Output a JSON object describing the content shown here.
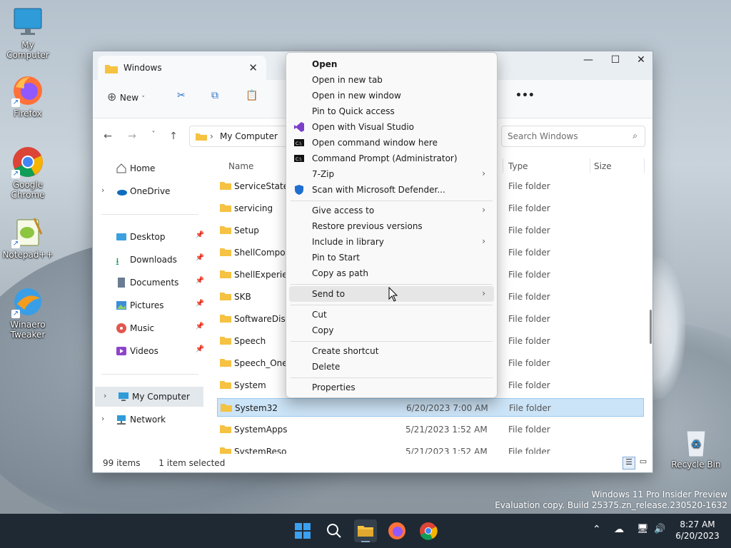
{
  "desktop": {
    "icons": [
      {
        "label": "My Computer"
      },
      {
        "label": "Firefox"
      },
      {
        "label": "Google Chrome"
      },
      {
        "label": "Notepad++"
      },
      {
        "label": "Winaero Tweaker"
      },
      {
        "label": "Recycle Bin"
      }
    ],
    "watermark_line1": "Windows 11 Pro Insider Preview",
    "watermark_line2": "Evaluation copy. Build 25375.zn_release.230520-1632"
  },
  "explorer": {
    "tab_title": "Windows",
    "toolbar": {
      "new_label": "New",
      "more_label": "•••"
    },
    "address": {
      "path_root": "My Computer",
      "search_placeholder": "Search Windows"
    },
    "nav": {
      "home": "Home",
      "onedrive": "OneDrive",
      "desktop": "Desktop",
      "downloads": "Downloads",
      "documents": "Documents",
      "pictures": "Pictures",
      "music": "Music",
      "videos": "Videos",
      "mycomputer": "My Computer",
      "network": "Network"
    },
    "columns": {
      "name": "Name",
      "type": "Type",
      "size": "Size"
    },
    "rows": [
      {
        "name": "ServiceState",
        "date": "",
        "type": "File folder"
      },
      {
        "name": "servicing",
        "date": "",
        "type": "File folder"
      },
      {
        "name": "Setup",
        "date": "",
        "type": "File folder"
      },
      {
        "name": "ShellComponents",
        "date": "",
        "type": "File folder"
      },
      {
        "name": "ShellExperiences",
        "date": "",
        "type": "File folder"
      },
      {
        "name": "SKB",
        "date": "",
        "type": "File folder"
      },
      {
        "name": "SoftwareDistribution",
        "date": "",
        "type": "File folder"
      },
      {
        "name": "Speech",
        "date": "",
        "type": "File folder"
      },
      {
        "name": "Speech_OneCore",
        "date": "",
        "type": "File folder"
      },
      {
        "name": "System",
        "date": "",
        "type": "File folder"
      },
      {
        "name": "System32",
        "date": "6/20/2023 7:00 AM",
        "type": "File folder"
      },
      {
        "name": "SystemApps",
        "date": "5/21/2023 1:52 AM",
        "type": "File folder"
      },
      {
        "name": "SystemResources",
        "date": "5/21/2023 1:52 AM",
        "type": "File folder"
      }
    ],
    "status": {
      "count": "99 items",
      "selected": "1 item selected"
    }
  },
  "context_menu": {
    "open": "Open",
    "open_new_tab": "Open in new tab",
    "open_new_window": "Open in new window",
    "pin_quick": "Pin to Quick access",
    "open_vs": "Open with Visual Studio",
    "open_cmd": "Open command window here",
    "cmd_admin": "Command Prompt (Administrator)",
    "zip": "7-Zip",
    "defender": "Scan with Microsoft Defender...",
    "give_access": "Give access to",
    "restore": "Restore previous versions",
    "include_library": "Include in library",
    "pin_start": "Pin to Start",
    "copy_path": "Copy as path",
    "send_to": "Send to",
    "cut": "Cut",
    "copy": "Copy",
    "create_shortcut": "Create shortcut",
    "delete": "Delete",
    "properties": "Properties"
  },
  "taskbar": {
    "time": "8:27 AM",
    "date": "6/20/2023"
  }
}
